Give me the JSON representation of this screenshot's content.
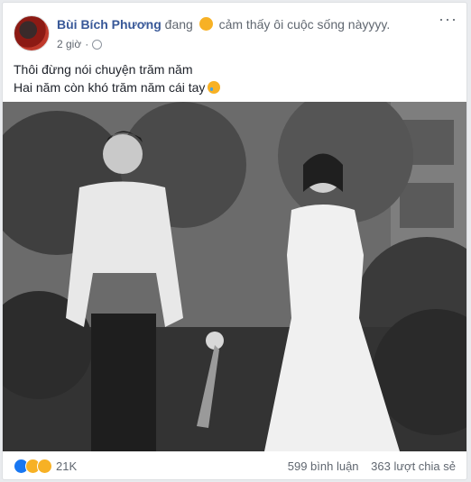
{
  "post": {
    "author": "Bùi Bích Phương",
    "feeling_prefix": "đang",
    "feeling_text": "cảm thấy ôi cuộc sống nàyyyy.",
    "time": "2 giờ",
    "more_label": "···",
    "body_line1": "Thôi đừng nói chuyện trăm năm",
    "body_line2": "Hai năm còn khó trăm năm cái tay"
  },
  "footer": {
    "reaction_count": "21K",
    "comments": "599 bình luận",
    "shares": "363 lượt chia sẻ"
  },
  "icons": {
    "privacy": "globe-icon",
    "reactions": [
      "like-icon",
      "haha-icon",
      "sad-icon"
    ]
  }
}
